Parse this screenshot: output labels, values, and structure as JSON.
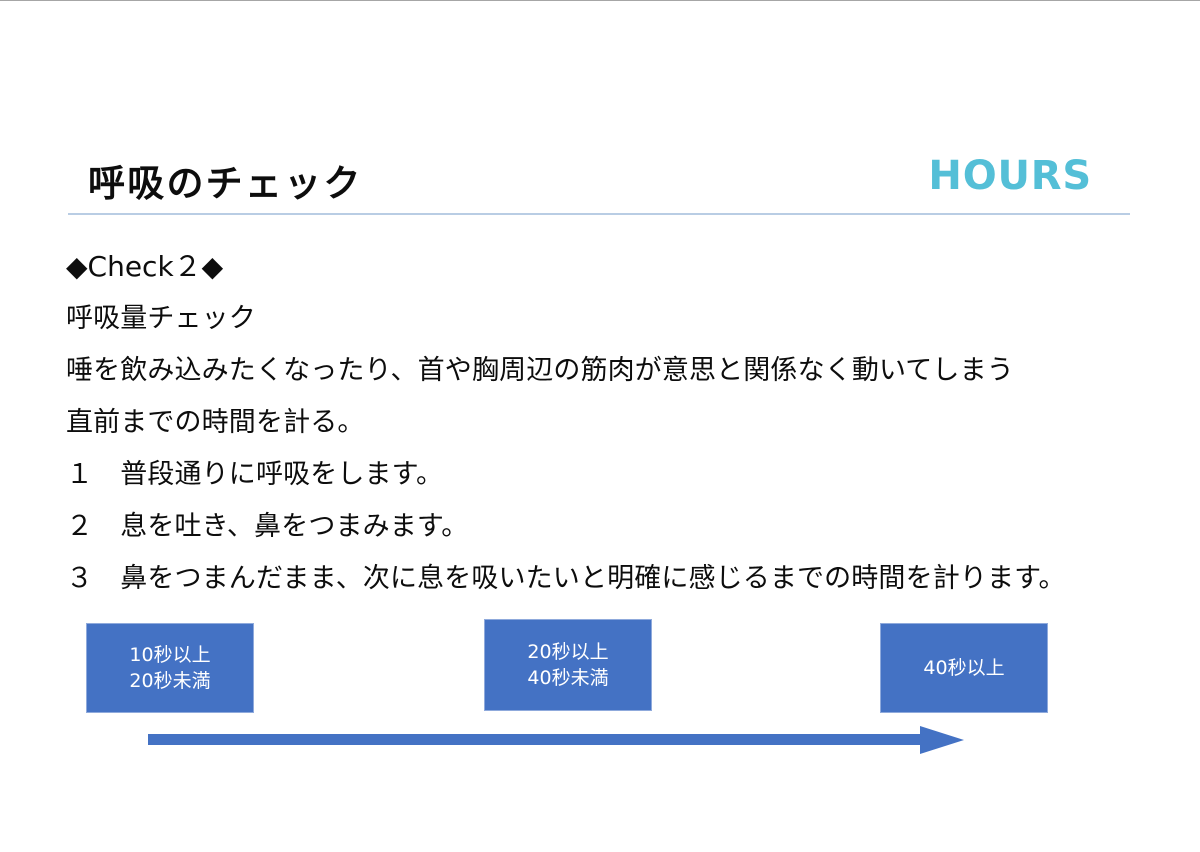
{
  "slide": {
    "title": "呼吸のチェック",
    "brand": "HOURS",
    "body_lines": [
      "◆Check２◆",
      "呼吸量チェック",
      "唾を飲み込みたくなったり、首や胸周辺の筋肉が意思と関係なく動いてしまう",
      "直前までの時間を計る。",
      "１　普段通りに呼吸をします。",
      "２　息を吐き、鼻をつまみます。",
      "３　鼻をつまんだまま、次に息を吸いたいと明確に感じるまでの時間を計ります。"
    ]
  },
  "diagram": {
    "boxes": [
      {
        "line1": "10秒以上",
        "line2": "20秒未満"
      },
      {
        "line1": "20秒以上",
        "line2": "40秒未満"
      },
      {
        "line1": "40秒以上",
        "line2": ""
      }
    ],
    "arrow_direction": "right"
  },
  "colors": {
    "brand_cyan": "#54bfd7",
    "box_blue": "#4472c4",
    "box_border": "#8faadc",
    "rule_blue": "#b9cde4",
    "text_black": "#0d0d0d",
    "arrow_blue": "#4472c4"
  }
}
